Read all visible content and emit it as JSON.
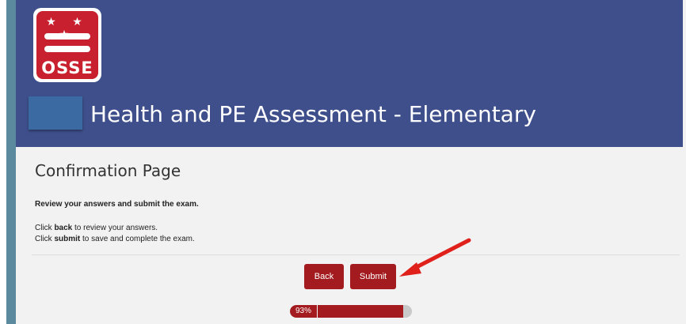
{
  "logo": {
    "stars": "★ ★ ★",
    "text": "OSSE"
  },
  "header": {
    "title": "Health and PE Assessment - Elementary"
  },
  "page": {
    "heading": "Confirmation Page",
    "instruction": "Review your answers and submit the exam.",
    "line1": {
      "prefix": "Click ",
      "keyword": "back",
      "suffix": " to review your answers."
    },
    "line2": {
      "prefix": "Click ",
      "keyword": "submit",
      "suffix": " to save and complete the exam."
    }
  },
  "buttons": {
    "back_label": "Back",
    "submit_label": "Submit"
  },
  "progress": {
    "label": "93%",
    "value": 0.93
  },
  "colors": {
    "header_bg": "#3e4f8c",
    "accent": "#a31b1f",
    "arrow": "#e0211b"
  }
}
